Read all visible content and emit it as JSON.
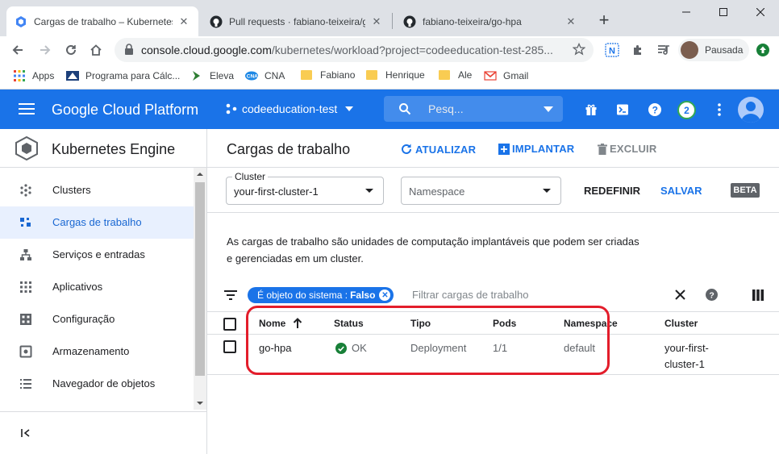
{
  "browser": {
    "tabs": [
      {
        "title": "Cargas de trabalho – Kubernetes",
        "active": true
      },
      {
        "title": "Pull requests · fabiano-teixeira/go",
        "active": false
      },
      {
        "title": "fabiano-teixeira/go-hpa",
        "active": false
      }
    ],
    "url_host": "console.cloud.google.com",
    "url_path": "/kubernetes/workload?project=codeeducation-test-285...",
    "profile_label": "Pausada",
    "bookmarks": [
      "Apps",
      "Programa para Cálc...",
      "Eleva",
      "CNA",
      "Fabiano",
      "Henrique",
      "Ale",
      "Gmail"
    ]
  },
  "header": {
    "title": "Google Cloud Platform",
    "project": "codeeducation-test",
    "search_placeholder": "Pesq...",
    "notifications": "2"
  },
  "sidebar": {
    "product": "Kubernetes Engine",
    "items": [
      {
        "label": "Clusters",
        "icon": "clusters-icon"
      },
      {
        "label": "Cargas de trabalho",
        "icon": "workloads-icon",
        "active": true
      },
      {
        "label": "Serviços e entradas",
        "icon": "services-icon"
      },
      {
        "label": "Aplicativos",
        "icon": "apps-grid-icon"
      },
      {
        "label": "Configuração",
        "icon": "config-icon"
      },
      {
        "label": "Armazenamento",
        "icon": "storage-icon"
      },
      {
        "label": "Navegador de objetos",
        "icon": "list-icon"
      }
    ]
  },
  "main": {
    "title": "Cargas de trabalho",
    "actions": {
      "refresh": "ATUALIZAR",
      "deploy": "IMPLANTAR",
      "delete": "EXCLUIR"
    },
    "filters": {
      "cluster_label": "Cluster",
      "cluster_value": "your-first-cluster-1",
      "namespace_placeholder": "Namespace",
      "reset": "REDEFINIR",
      "save": "SALVAR",
      "beta": "BETA"
    },
    "description_line1": "As cargas de trabalho são unidades de computação implantáveis que podem ser criadas",
    "description_line2": "e gerenciadas em um cluster.",
    "chip": {
      "label": "É objeto do sistema :",
      "value": "Falso"
    },
    "filter_placeholder": "Filtrar cargas de trabalho",
    "table": {
      "headers": [
        "Nome",
        "Status",
        "Tipo",
        "Pods",
        "Namespace",
        "Cluster"
      ],
      "rows": [
        {
          "name": "go-hpa",
          "status": "OK",
          "type": "Deployment",
          "pods": "1/1",
          "namespace": "default",
          "cluster_line1": "your-first-",
          "cluster_line2": "cluster-1"
        }
      ]
    }
  },
  "colors": {
    "brand": "#1a73e8",
    "ok": "#188038",
    "annotation": "#e31d2b"
  }
}
